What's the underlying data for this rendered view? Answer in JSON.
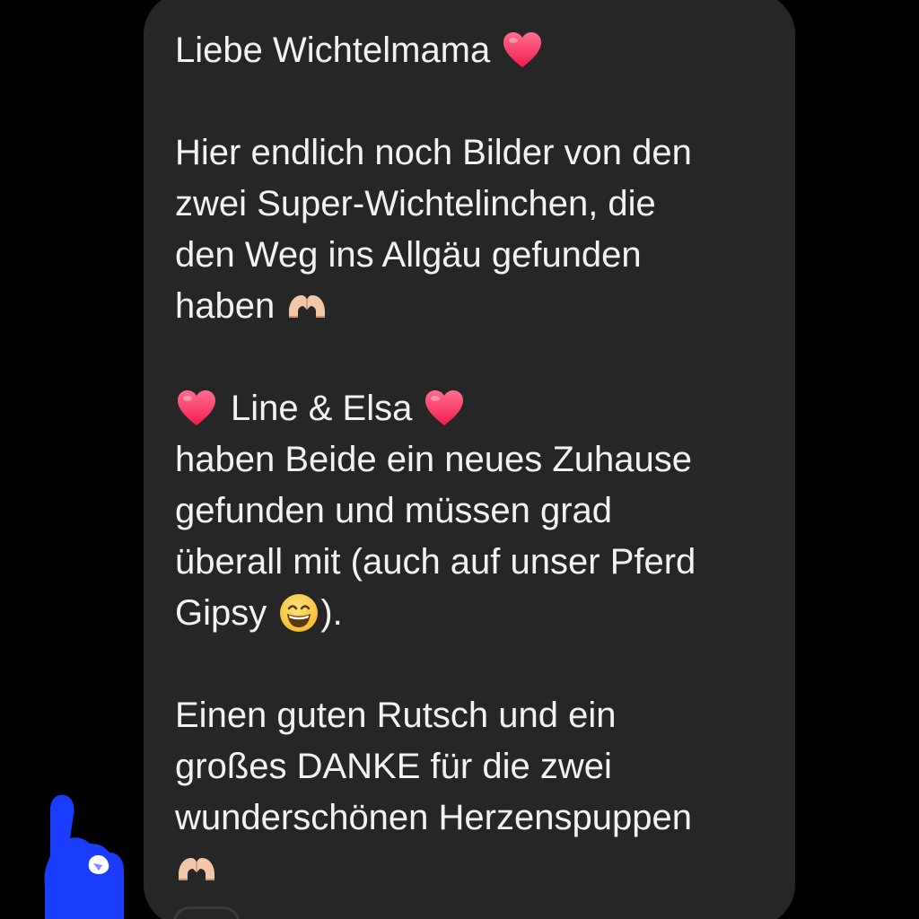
{
  "message": {
    "lines": [
      "Liebe Wichtelmama",
      "Hier endlich noch Bilder von den",
      "zwei Super-Wichtelinchen, die",
      "den Weg ins Allgäu gefunden",
      "haben",
      "Line & Elsa",
      "haben Beide ein neues Zuhause",
      "gefunden und müssen grad",
      "überall mit (auch auf unser Pferd",
      "Gipsy",
      ").",
      "Einen guten Rutsch und ein",
      "großes DANKE für die zwei",
      "wunderschönen Herzenspuppen"
    ],
    "emojis": {
      "heart": "red-heart-icon",
      "heart_hands": "heart-hands-icon",
      "grin": "grinning-face-icon"
    }
  },
  "colors": {
    "bubble_bg": "#262626",
    "text": "#f2f2f2",
    "heart": "#ff3c68",
    "avatar_blue": "#1a3cff"
  }
}
